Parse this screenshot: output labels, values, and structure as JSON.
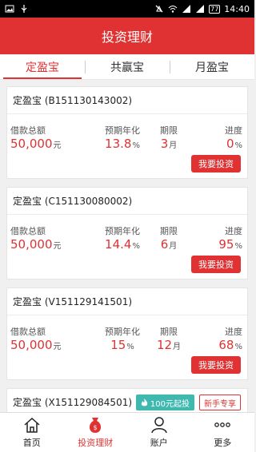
{
  "status_bar": {
    "battery": "77",
    "time": "14:40"
  },
  "app_bar": {
    "title": "投资理财"
  },
  "tabs": [
    {
      "label": "定盈宝",
      "active": true
    },
    {
      "label": "共赢宝",
      "active": false
    },
    {
      "label": "月盈宝",
      "active": false
    }
  ],
  "labels": {
    "amount": "借款总额",
    "rate": "预期年化",
    "term": "期限",
    "progress": "进度",
    "invest": "我要投资"
  },
  "units": {
    "amount": "元",
    "rate": "%",
    "term": "月",
    "progress": "%"
  },
  "cards": [
    {
      "title": "定盈宝 (B151130143002)",
      "amount": "50,000",
      "rate": "13.8",
      "term": "3",
      "progress": "0"
    },
    {
      "title": "定盈宝 (C151130080002)",
      "amount": "50,000",
      "rate": "14.4",
      "term": "6",
      "progress": "95"
    },
    {
      "title": "定盈宝 (V151129141501)",
      "amount": "50,000",
      "rate": "15",
      "term": "12",
      "progress": "68"
    }
  ],
  "partial_card": {
    "title": "定盈宝 (X151129084501)",
    "badge_min": "100元起投",
    "badge_new": "新手专享"
  },
  "bottom_nav": [
    {
      "label": "首页",
      "icon": "home-icon",
      "active": false
    },
    {
      "label": "投资理财",
      "icon": "money-bag-icon",
      "active": true
    },
    {
      "label": "账户",
      "icon": "user-icon",
      "active": false
    },
    {
      "label": "更多",
      "icon": "more-icon",
      "active": false
    }
  ],
  "colors": {
    "brand_red": "#e03232",
    "teal": "#3fb8b0"
  }
}
